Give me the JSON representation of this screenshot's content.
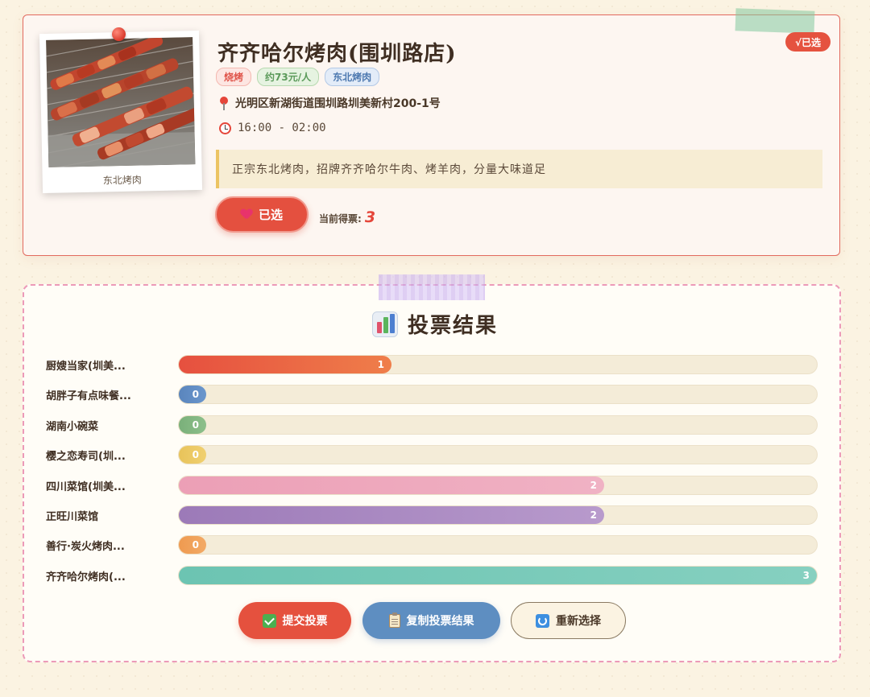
{
  "restaurant": {
    "name": "齐齐哈尔烤肉(围圳路店)",
    "selected_badge": "√已选",
    "photo_caption": "东北烤肉",
    "tags": [
      "烧烤",
      "约73元/人",
      "东北烤肉"
    ],
    "address": "光明区新湖街道围圳路圳美新村200-1号",
    "hours": "16:00 - 02:00",
    "description": "正宗东北烤肉，招牌齐齐哈尔牛肉、烤羊肉，分量大味道足",
    "vote_button_label": "已选",
    "current_votes_label": "当前得票:",
    "current_votes": "3"
  },
  "results": {
    "title": "投票结果",
    "max_votes": 3,
    "items": [
      {
        "name": "厨嫂当家(圳美...",
        "votes": 1,
        "color_from": "#e6503f",
        "color_to": "#ef7e4a"
      },
      {
        "name": "胡胖子有点味餐...",
        "votes": 0,
        "color_from": "#5a85bd",
        "color_to": "#6a96cc"
      },
      {
        "name": "湖南小碗菜",
        "votes": 0,
        "color_from": "#7ab07a",
        "color_to": "#8cbf8a"
      },
      {
        "name": "樱之恋寿司(圳...",
        "votes": 0,
        "color_from": "#e8c35a",
        "color_to": "#f0d070"
      },
      {
        "name": "四川菜馆(圳美...",
        "votes": 2,
        "color_from": "#ec9fb6",
        "color_to": "#f0b2c4"
      },
      {
        "name": "正旺川菜馆",
        "votes": 2,
        "color_from": "#9c7ab8",
        "color_to": "#b89acc"
      },
      {
        "name": "善行·炭火烤肉...",
        "votes": 0,
        "color_from": "#ef9a50",
        "color_to": "#f2aa66"
      },
      {
        "name": "齐齐哈尔烤肉(...",
        "votes": 3,
        "color_from": "#6cc4b2",
        "color_to": "#86d0c0"
      }
    ]
  },
  "actions": {
    "submit": "提交投票",
    "copy": "复制投票结果",
    "reset": "重新选择"
  },
  "colors": {
    "accent_red": "#e5513e",
    "accent_blue": "#5e8ec1",
    "background": "#fbf3e2"
  }
}
